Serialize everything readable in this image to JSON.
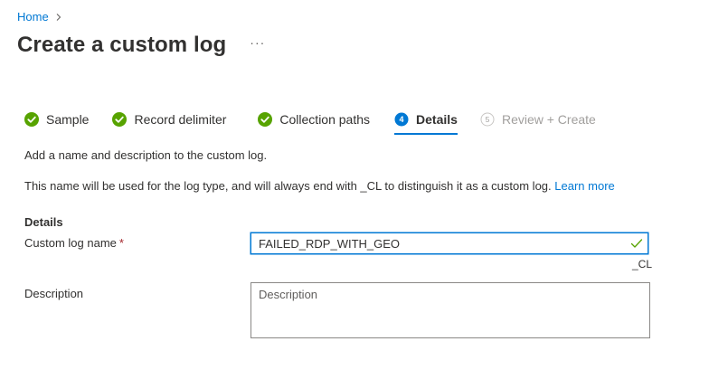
{
  "breadcrumb": {
    "home": "Home"
  },
  "page": {
    "title": "Create a custom log",
    "more": "···"
  },
  "steps": [
    {
      "label": "Sample",
      "state": "complete"
    },
    {
      "label": "Record delimiter",
      "state": "complete"
    },
    {
      "label": "Collection paths",
      "state": "complete"
    },
    {
      "label": "Details",
      "number": "4",
      "state": "current"
    },
    {
      "label": "Review + Create",
      "number": "5",
      "state": "disabled"
    }
  ],
  "intro": {
    "line1": "Add a name and description to the custom log.",
    "line2": "This name will be used for the log type, and will always end with _CL to distinguish it as a custom log.",
    "learn_more": "Learn more"
  },
  "details": {
    "section_title": "Details",
    "name_label": "Custom log name",
    "required_mark": "*",
    "name_value": "FAILED_RDP_WITH_GEO",
    "suffix": "_CL",
    "description_label": "Description",
    "description_placeholder": "Description",
    "description_value": ""
  },
  "colors": {
    "accent": "#0078d4",
    "success": "#57a300",
    "required": "#a4262c",
    "disabled": "#a19f9d"
  },
  "icons": {
    "complete": "check-circle-icon",
    "valid": "checkmark-icon",
    "breadcrumb_separator": "chevron-right-icon"
  }
}
